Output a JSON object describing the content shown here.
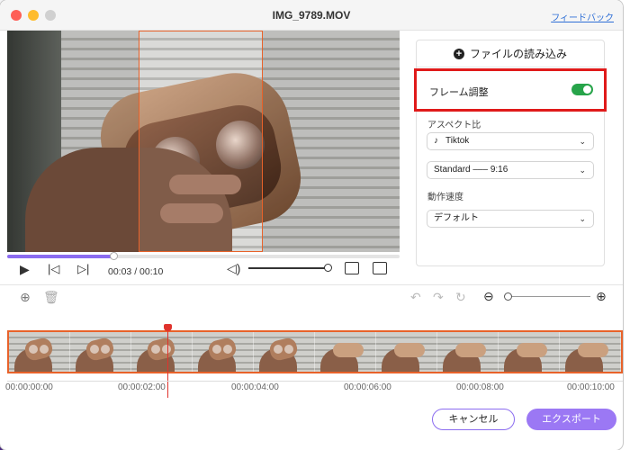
{
  "window": {
    "title": "IMG_9789.MOV",
    "feedback_link": "フィードバック"
  },
  "player": {
    "time_current": "00:03",
    "time_total": "00:10",
    "time_separator": "/",
    "progress_fraction": 0.27
  },
  "panel": {
    "load_file_label": "ファイルの読み込み",
    "frame_adjust_label": "フレーム調整",
    "frame_adjust_enabled": true,
    "aspect_ratio_label": "アスペクト比",
    "aspect_ratio_value": "Tiktok",
    "ratio_preset_value": "Standard ––– 9:16",
    "motion_speed_label": "動作速度",
    "motion_speed_value": "デフォルト"
  },
  "timeline": {
    "tick_labels": [
      "00:00:00:00",
      "00:00:02:00",
      "00:00:04:00",
      "00:00:06:00",
      "00:00:08:00",
      "00:00:10:00"
    ],
    "playhead_time_seconds": 2.7
  },
  "actions": {
    "cancel_label": "キャンセル",
    "export_label": "エクスポート"
  },
  "colors": {
    "accent": "#9b78f4",
    "crop_outline": "#e8622a",
    "highlight_box": "#e01a1a",
    "toggle_on": "#27a44a",
    "playhead": "#e0332d"
  }
}
